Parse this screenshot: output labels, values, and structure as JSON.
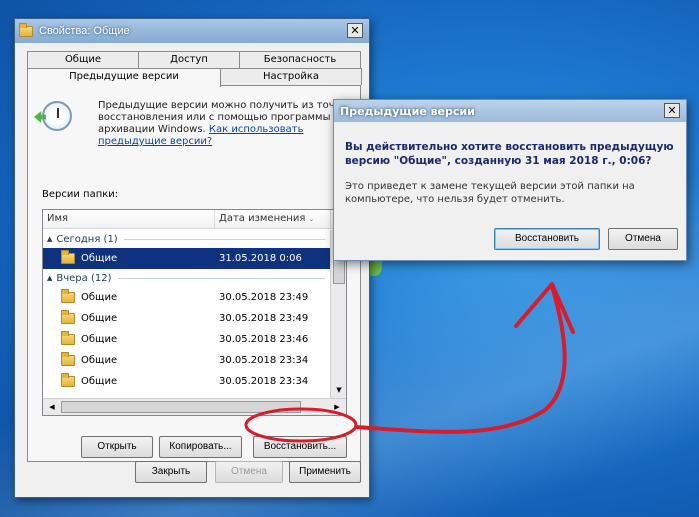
{
  "window": {
    "title": "Свойства: Общие",
    "close_symbol": "✕",
    "tabs_row1": [
      "Общие",
      "Доступ",
      "Безопасность"
    ],
    "tabs_row2": [
      "Предыдущие версии",
      "Настройка"
    ],
    "active_tab": "Предыдущие версии",
    "info_text": "Предыдущие версии можно получить из точек восстановления или с помощью программы архивации Windows.",
    "info_link": "Как использовать предыдущие версии?",
    "versions_label": "Версии папки:",
    "columns": {
      "name": "Имя",
      "date": "Дата изменения"
    },
    "groups": [
      {
        "label": "Сегодня (1)",
        "rows": [
          {
            "name": "Общие",
            "date": "31.05.2018 0:06",
            "selected": true
          }
        ]
      },
      {
        "label": "Вчера (12)",
        "rows": [
          {
            "name": "Общие",
            "date": "30.05.2018 23:49"
          },
          {
            "name": "Общие",
            "date": "30.05.2018 23:49"
          },
          {
            "name": "Общие",
            "date": "30.05.2018 23:46"
          },
          {
            "name": "Общие",
            "date": "30.05.2018 23:34"
          },
          {
            "name": "Общие",
            "date": "30.05.2018 23:34"
          }
        ]
      }
    ],
    "buttons": {
      "open": "Открыть",
      "copy": "Копировать...",
      "restore": "Восстановить...",
      "close": "Закрыть",
      "cancel": "Отмена",
      "apply": "Применить"
    }
  },
  "dialog": {
    "title": "Предыдущие версии",
    "close_symbol": "✕",
    "question": "Вы действительно хотите восстановить предыдущую версию \"Общие\", созданную 31 мая 2018 г., 0:06?",
    "description": "Это приведет к замене текущей версии этой папки на компьютере, что нельзя будет отменить.",
    "restore_button": "Восстановить",
    "cancel_button": "Отмена"
  },
  "annotation": {
    "color": "#d81c2c"
  }
}
